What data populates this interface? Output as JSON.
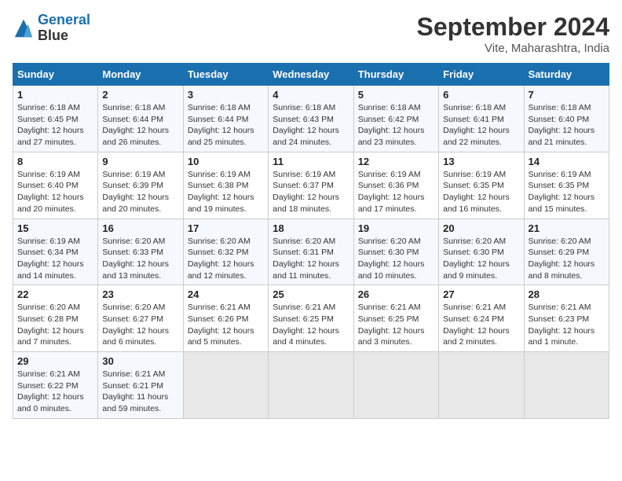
{
  "header": {
    "logo_line1": "General",
    "logo_line2": "Blue",
    "month": "September 2024",
    "location": "Vite, Maharashtra, India"
  },
  "weekdays": [
    "Sunday",
    "Monday",
    "Tuesday",
    "Wednesday",
    "Thursday",
    "Friday",
    "Saturday"
  ],
  "weeks": [
    [
      {
        "day": "1",
        "sunrise": "6:18 AM",
        "sunset": "6:45 PM",
        "daylight": "12 hours and 27 minutes."
      },
      {
        "day": "2",
        "sunrise": "6:18 AM",
        "sunset": "6:44 PM",
        "daylight": "12 hours and 26 minutes."
      },
      {
        "day": "3",
        "sunrise": "6:18 AM",
        "sunset": "6:44 PM",
        "daylight": "12 hours and 25 minutes."
      },
      {
        "day": "4",
        "sunrise": "6:18 AM",
        "sunset": "6:43 PM",
        "daylight": "12 hours and 24 minutes."
      },
      {
        "day": "5",
        "sunrise": "6:18 AM",
        "sunset": "6:42 PM",
        "daylight": "12 hours and 23 minutes."
      },
      {
        "day": "6",
        "sunrise": "6:18 AM",
        "sunset": "6:41 PM",
        "daylight": "12 hours and 22 minutes."
      },
      {
        "day": "7",
        "sunrise": "6:18 AM",
        "sunset": "6:40 PM",
        "daylight": "12 hours and 21 minutes."
      }
    ],
    [
      {
        "day": "8",
        "sunrise": "6:19 AM",
        "sunset": "6:40 PM",
        "daylight": "12 hours and 20 minutes."
      },
      {
        "day": "9",
        "sunrise": "6:19 AM",
        "sunset": "6:39 PM",
        "daylight": "12 hours and 20 minutes."
      },
      {
        "day": "10",
        "sunrise": "6:19 AM",
        "sunset": "6:38 PM",
        "daylight": "12 hours and 19 minutes."
      },
      {
        "day": "11",
        "sunrise": "6:19 AM",
        "sunset": "6:37 PM",
        "daylight": "12 hours and 18 minutes."
      },
      {
        "day": "12",
        "sunrise": "6:19 AM",
        "sunset": "6:36 PM",
        "daylight": "12 hours and 17 minutes."
      },
      {
        "day": "13",
        "sunrise": "6:19 AM",
        "sunset": "6:35 PM",
        "daylight": "12 hours and 16 minutes."
      },
      {
        "day": "14",
        "sunrise": "6:19 AM",
        "sunset": "6:35 PM",
        "daylight": "12 hours and 15 minutes."
      }
    ],
    [
      {
        "day": "15",
        "sunrise": "6:19 AM",
        "sunset": "6:34 PM",
        "daylight": "12 hours and 14 minutes."
      },
      {
        "day": "16",
        "sunrise": "6:20 AM",
        "sunset": "6:33 PM",
        "daylight": "12 hours and 13 minutes."
      },
      {
        "day": "17",
        "sunrise": "6:20 AM",
        "sunset": "6:32 PM",
        "daylight": "12 hours and 12 minutes."
      },
      {
        "day": "18",
        "sunrise": "6:20 AM",
        "sunset": "6:31 PM",
        "daylight": "12 hours and 11 minutes."
      },
      {
        "day": "19",
        "sunrise": "6:20 AM",
        "sunset": "6:30 PM",
        "daylight": "12 hours and 10 minutes."
      },
      {
        "day": "20",
        "sunrise": "6:20 AM",
        "sunset": "6:30 PM",
        "daylight": "12 hours and 9 minutes."
      },
      {
        "day": "21",
        "sunrise": "6:20 AM",
        "sunset": "6:29 PM",
        "daylight": "12 hours and 8 minutes."
      }
    ],
    [
      {
        "day": "22",
        "sunrise": "6:20 AM",
        "sunset": "6:28 PM",
        "daylight": "12 hours and 7 minutes."
      },
      {
        "day": "23",
        "sunrise": "6:20 AM",
        "sunset": "6:27 PM",
        "daylight": "12 hours and 6 minutes."
      },
      {
        "day": "24",
        "sunrise": "6:21 AM",
        "sunset": "6:26 PM",
        "daylight": "12 hours and 5 minutes."
      },
      {
        "day": "25",
        "sunrise": "6:21 AM",
        "sunset": "6:25 PM",
        "daylight": "12 hours and 4 minutes."
      },
      {
        "day": "26",
        "sunrise": "6:21 AM",
        "sunset": "6:25 PM",
        "daylight": "12 hours and 3 minutes."
      },
      {
        "day": "27",
        "sunrise": "6:21 AM",
        "sunset": "6:24 PM",
        "daylight": "12 hours and 2 minutes."
      },
      {
        "day": "28",
        "sunrise": "6:21 AM",
        "sunset": "6:23 PM",
        "daylight": "12 hours and 1 minute."
      }
    ],
    [
      {
        "day": "29",
        "sunrise": "6:21 AM",
        "sunset": "6:22 PM",
        "daylight": "12 hours and 0 minutes."
      },
      {
        "day": "30",
        "sunrise": "6:21 AM",
        "sunset": "6:21 PM",
        "daylight": "11 hours and 59 minutes."
      },
      null,
      null,
      null,
      null,
      null
    ]
  ]
}
